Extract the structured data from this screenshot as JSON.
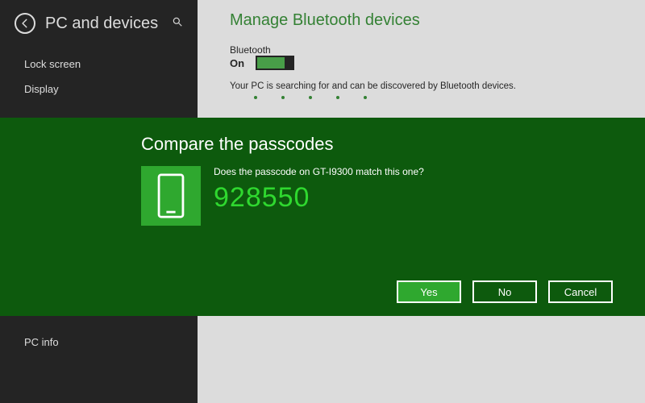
{
  "sidebar": {
    "title": "PC and devices",
    "items": [
      {
        "label": "Lock screen"
      },
      {
        "label": "Display"
      }
    ],
    "bottom_item": {
      "label": "PC info"
    }
  },
  "main": {
    "title": "Manage Bluetooth devices",
    "bluetooth_label": "Bluetooth",
    "bluetooth_state": "On",
    "status_text": "Your PC is searching for and can be discovered by Bluetooth devices."
  },
  "dialog": {
    "title": "Compare the passcodes",
    "question": "Does the passcode on GT-I9300 match this one?",
    "passcode": "928550",
    "buttons": {
      "yes": "Yes",
      "no": "No",
      "cancel": "Cancel"
    }
  }
}
